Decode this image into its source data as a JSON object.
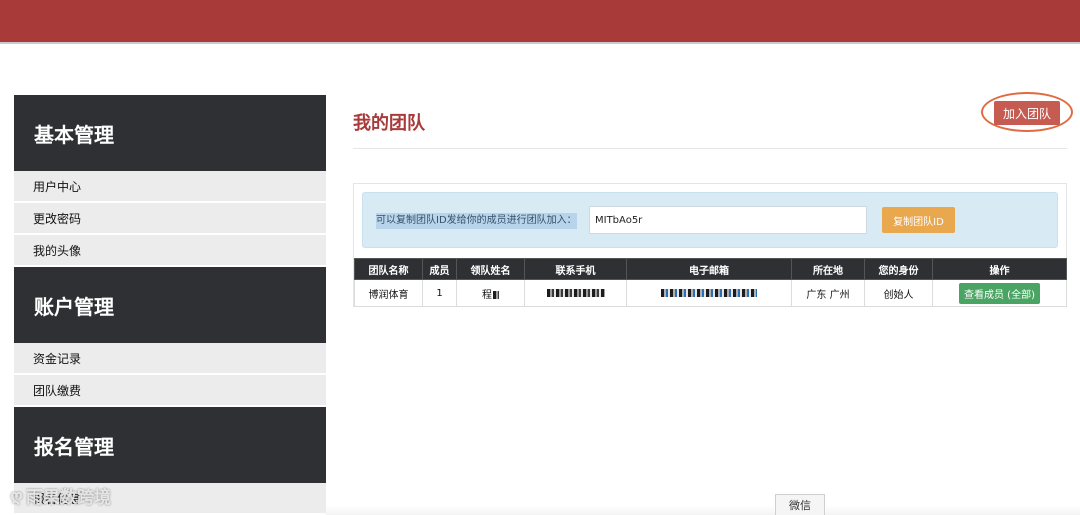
{
  "sidebar": {
    "sections": [
      {
        "title": "基本管理",
        "items": [
          "用户中心",
          "更改密码",
          "我的头像"
        ]
      },
      {
        "title": "账户管理",
        "items": [
          "资金记录",
          "团队缴费"
        ]
      },
      {
        "title": "报名管理",
        "items": [
          "报名信息"
        ]
      }
    ]
  },
  "main": {
    "title": "我的团队",
    "join_button": "加入团队",
    "hint": "可以复制团队ID发给你的成员进行团队加入：",
    "team_id": "MITbAo5r",
    "copy_button": "复制团队ID",
    "table": {
      "headers": [
        "团队名称",
        "成员",
        "领队姓名",
        "联系手机",
        "电子邮箱",
        "所在地",
        "您的身份",
        "操作"
      ],
      "rows": [
        {
          "team_name": "博润体育",
          "members": "1",
          "leader": "程",
          "location": "广东 广州",
          "role": "创始人",
          "action": "查看成员 (全部)"
        }
      ]
    }
  },
  "footer": {
    "watermark": "雨果数跨境",
    "wechat_tab": "微信"
  },
  "colors": {
    "topbar": "#a83a3a",
    "title": "#a83a3a",
    "sidebar_header": "#2f3033",
    "join_button": "#c65b52",
    "copy_button": "#e9a74e",
    "view_button": "#4aa463",
    "info_box": "#d8ebf5"
  },
  "icons": {
    "watermark_logo": "logo-icon"
  }
}
